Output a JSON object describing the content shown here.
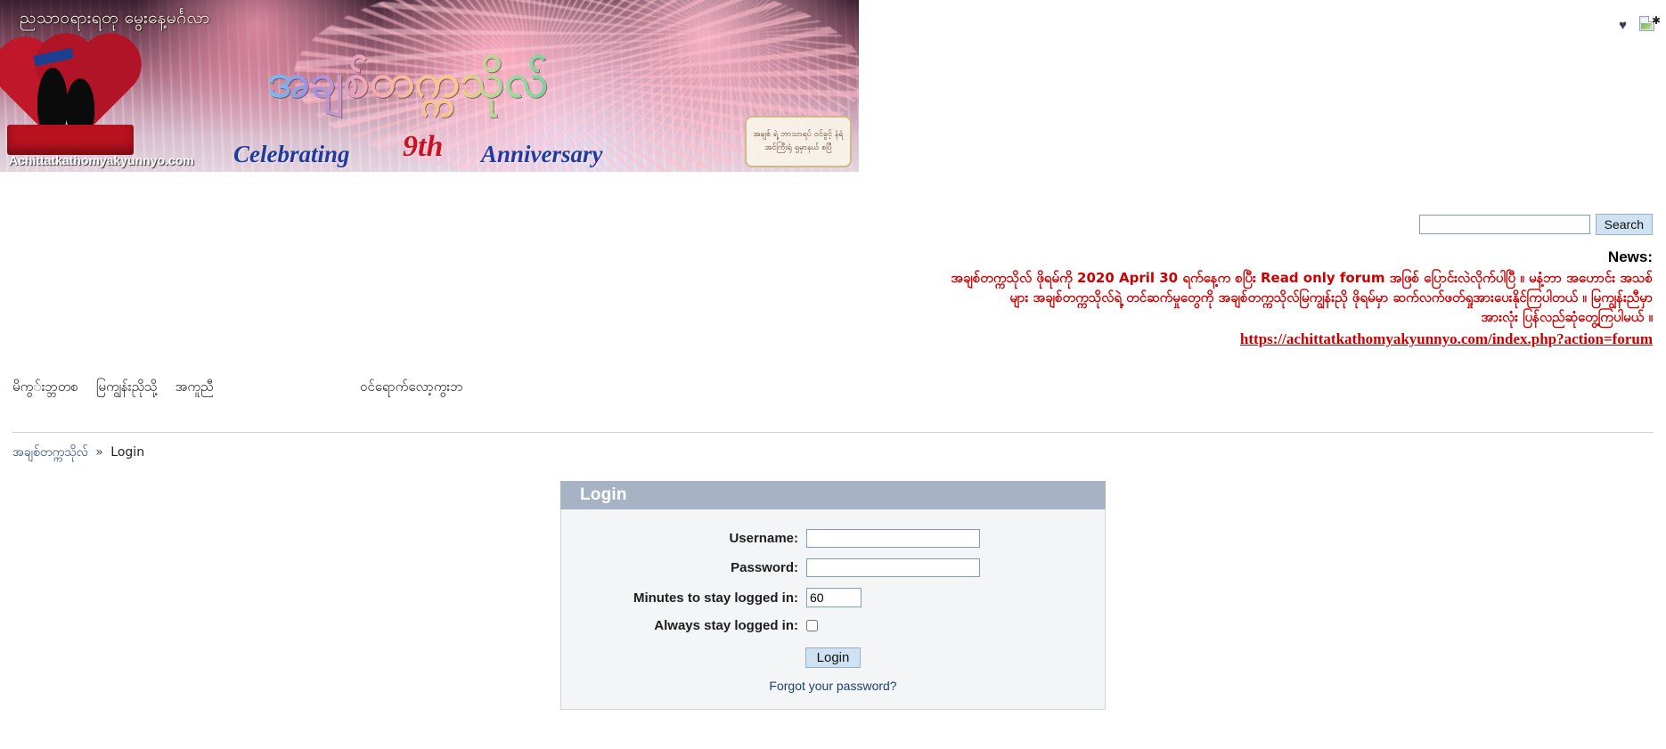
{
  "banner": {
    "top_text": "ညသာဝရားရတု မွေးနေ့မင်္ဂလာ",
    "main_text": "အချစ်တက္ကသိုလ်",
    "celebrating": "Celebrating",
    "anniversary_number": "9th",
    "anniversary_word": "Anniversary",
    "domain": "Achittatkathomyakyunnyo.com",
    "badge_line1": "အချစ် ရဲ့ ဘာသာရပ် ဝင်ခွင့် နံရံ",
    "badge_line2": "အင်ကြီးရုံ ရှမှာနယ် စပြီ"
  },
  "topright": {
    "heart_icon": "heart-icon",
    "broken_image_icon": "broken-image-icon"
  },
  "search": {
    "value": "",
    "placeholder": "",
    "button_label": "Search"
  },
  "news": {
    "label": "News:",
    "line1": "အချစ်တက္ကသိုလ် ဖိုရမ်ကို 2020 April 30 ရက်နေ့က စပြီး Read only forum အဖြစ် ပြောင်းလဲလိုက်ပါပြီ ။ မနံ့ဘာ အဟောင်း အသစ်",
    "line2": "များ အချစ်တက္ကသိုလ်ရဲ့ တင်ဆက်မှုတွေကို အချစ်တက္ကသိုလ်မြကျွန်းညို ဖိုရမ်မှာ ဆက်လက်ဖတ်ရှုအားပေးနိုင်ကြပါတယ် ။ မြကျွန်းညီမှာ",
    "line3": "အားလုံး ပြန်လည်ဆုံတွေ့ကြပါမယ် ။",
    "url": "https://achittatkathomyakyunnyo.com/index.php?action=forum"
  },
  "nav": {
    "items": [
      {
        "label": "မိကွ‌်းဘ္ဘတစ",
        "name": "nav-home"
      },
      {
        "label": "မြကျွန်းညိုသို့",
        "name": "nav-forum"
      },
      {
        "label": "အကူညီ",
        "name": "nav-help"
      }
    ],
    "right_item": {
      "label": "ဝင်ရောက်လော့ကွးဘ",
      "name": "nav-login"
    }
  },
  "breadcrumb": {
    "root": "အချစ်တက္ကသိုလ်",
    "separator": "»",
    "current": "Login"
  },
  "login": {
    "title": "Login",
    "username_label": "Username:",
    "username_value": "",
    "password_label": "Password:",
    "password_value": "",
    "minutes_label": "Minutes to stay logged in:",
    "minutes_value": "60",
    "always_label": "Always stay logged in:",
    "always_checked": false,
    "submit_label": "Login",
    "forgot_label": "Forgot your password?"
  },
  "colors": {
    "panel_header": "#a6b3c4",
    "panel_body": "#f4f5f6",
    "button_blue": "#cfe2f3",
    "news_red": "#cc0000",
    "link_blue": "#1c3f74"
  }
}
